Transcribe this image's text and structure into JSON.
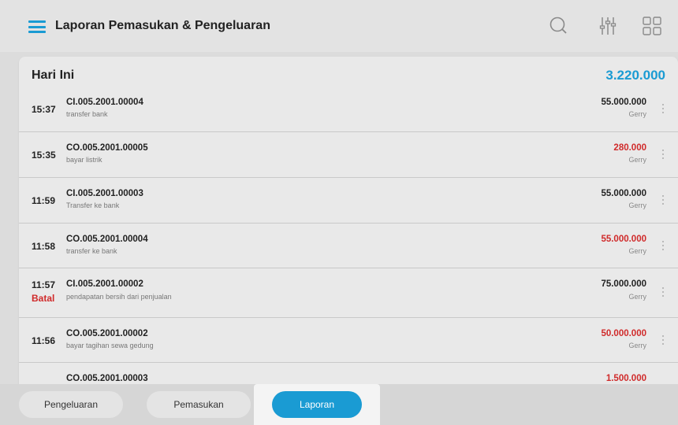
{
  "header": {
    "title": "Laporan Pemasukan & Pengeluaran",
    "icons": [
      "menu-icon",
      "search-icon",
      "filter-sliders-icon",
      "grid-view-icon"
    ]
  },
  "section": {
    "title": "Hari Ini",
    "total": "3.220.000"
  },
  "colors": {
    "accent": "#1a9bd3",
    "expense": "#d02a2a",
    "income": "#222222"
  },
  "transactions": [
    {
      "time": "15:37",
      "status": "",
      "code": "CI.005.2001.00004",
      "desc": "transfer bank",
      "amount": "55.000.000",
      "user": "Gerry",
      "type": "income"
    },
    {
      "time": "15:35",
      "status": "",
      "code": "CO.005.2001.00005",
      "desc": "bayar listrik",
      "amount": "280.000",
      "user": "Gerry",
      "type": "expense"
    },
    {
      "time": "11:59",
      "status": "",
      "code": "CI.005.2001.00003",
      "desc": "Transfer ke bank",
      "amount": "55.000.000",
      "user": "Gerry",
      "type": "income"
    },
    {
      "time": "11:58",
      "status": "",
      "code": "CO.005.2001.00004",
      "desc": "transfer ke bank",
      "amount": "55.000.000",
      "user": "Gerry",
      "type": "expense"
    },
    {
      "time": "11:57",
      "status": "Batal",
      "code": "CI.005.2001.00002",
      "desc": "pendapatan bersih dari penjualan",
      "amount": "75.000.000",
      "user": "Gerry",
      "type": "income"
    },
    {
      "time": "11:56",
      "status": "",
      "code": "CO.005.2001.00002",
      "desc": "bayar tagihan sewa gedung",
      "amount": "50.000.000",
      "user": "Gerry",
      "type": "expense"
    },
    {
      "time": "",
      "status": "",
      "code": "CO.005.2001.00003",
      "desc": "",
      "amount": "1.500.000",
      "user": "",
      "type": "expense"
    }
  ],
  "tabs": [
    {
      "label": "Pengeluaran",
      "active": false
    },
    {
      "label": "Pemasukan",
      "active": false
    },
    {
      "label": "Laporan",
      "active": true
    }
  ]
}
